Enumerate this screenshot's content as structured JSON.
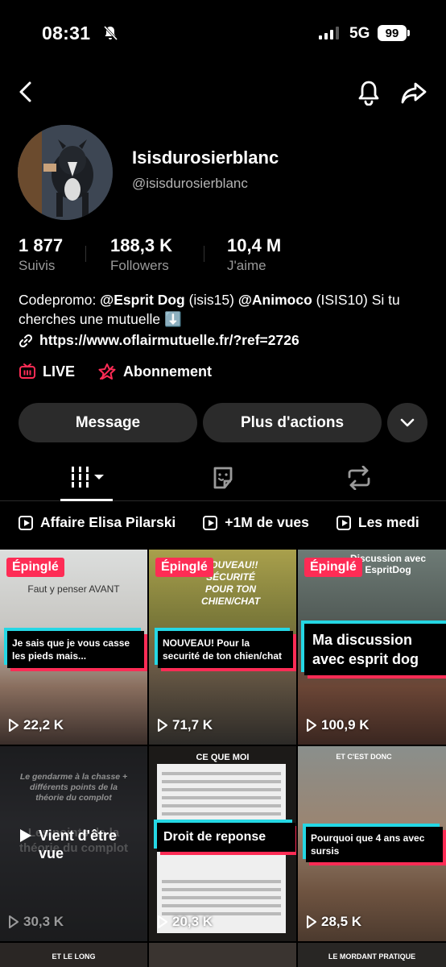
{
  "status_bar": {
    "time": "08:31",
    "network": "5G",
    "battery": "99"
  },
  "profile": {
    "display_name": "Isisdurosierblanc",
    "handle": "@isisdurosierblanc",
    "stats": [
      {
        "value": "1 877",
        "label": "Suivis"
      },
      {
        "value": "188,3 K",
        "label": "Followers"
      },
      {
        "value": "10,4 M",
        "label": "J'aime"
      }
    ],
    "bio": {
      "prefix": "Codepromo: ",
      "mention1": "@Esprit Dog",
      "code1": " (isis15) ",
      "mention2": "@Animoco",
      "code2": " (ISIS10) Si tu cherches une mutuelle ⬇️"
    },
    "link": "https://www.oflairmutuelle.fr/?ref=2726",
    "live_label": "LIVE",
    "subscription_label": "Abonnement"
  },
  "actions": {
    "message": "Message",
    "more": "Plus d'actions"
  },
  "playlists": [
    "Affaire Elisa Pilarski",
    "+1M de vues",
    "Les medi"
  ],
  "videos": [
    {
      "pinned": "Épinglé",
      "top": "Faut y penser AVANT",
      "caption": "Je sais que je vous casse les pieds mais...",
      "views": "22,2 K"
    },
    {
      "pinned": "Épinglé",
      "top": "NOUVEAU!! SÉCURITÉ POUR TON CHIEN/CHAT",
      "caption": "NOUVEAU! Pour la securité de ton chien/chat",
      "views": "71,7 K"
    },
    {
      "pinned": "Épinglé",
      "top": "Discussion avec EspritDog",
      "caption": "Ma discussion avec esprit dog",
      "views": "100,9 K"
    },
    {
      "top": "Le gendarme à la chasse + différents points de la théorie du complot",
      "caption": "Les points de la théorie du complot",
      "overlay": "Vient d'être vue",
      "views": "30,3 K"
    },
    {
      "top": "CE QUE MOI",
      "caption": "Droit de reponse",
      "views": "20,3 K"
    },
    {
      "top": "ET C'EST DONC",
      "caption": "Pourquoi que 4 ans avec sursis",
      "views": "28,5 K"
    }
  ],
  "next_row": [
    "ET LE LONG",
    "LE MORDANT PRATIQUE"
  ]
}
